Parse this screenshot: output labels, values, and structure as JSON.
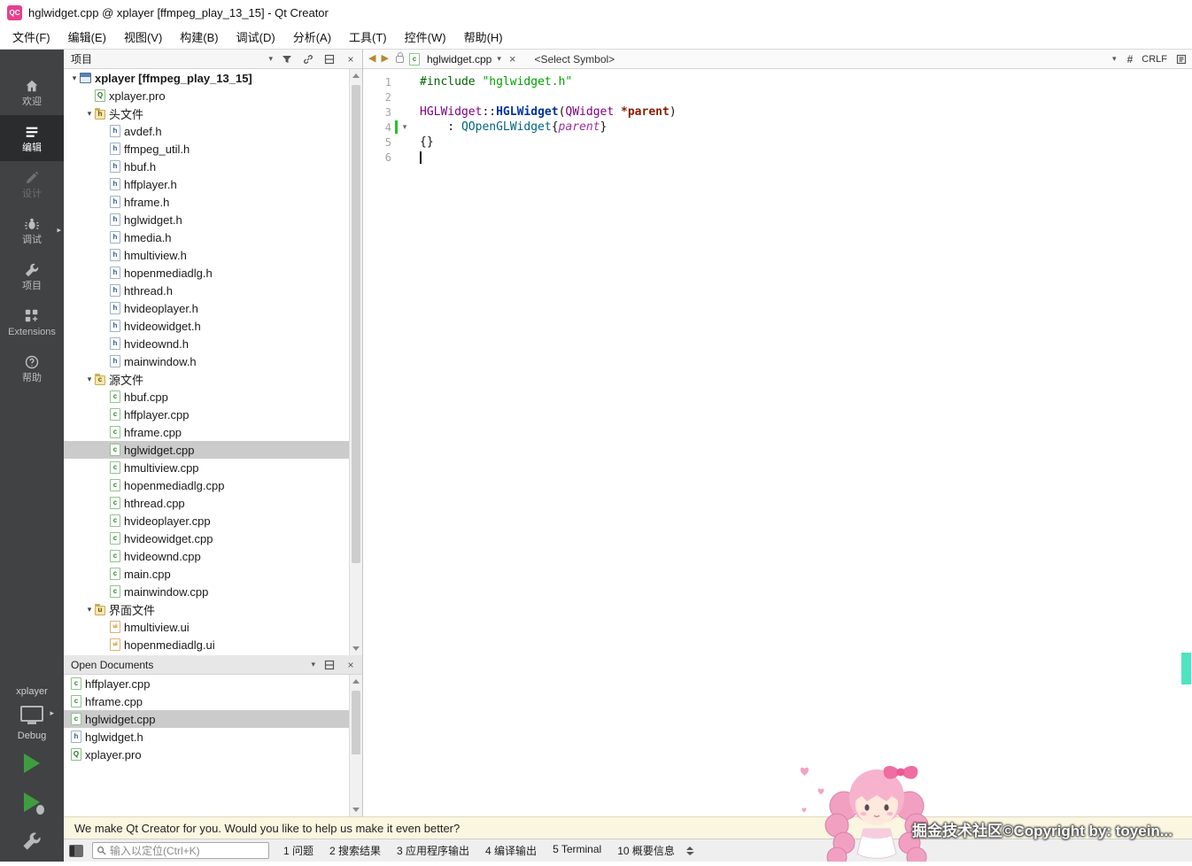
{
  "window": {
    "logo_text": "QC",
    "title": "hglwidget.cpp @ xplayer [ffmpeg_play_13_15] - Qt Creator"
  },
  "menu": {
    "items": [
      {
        "label": "文件(F)"
      },
      {
        "label": "编辑(E)"
      },
      {
        "label": "视图(V)"
      },
      {
        "label": "构建(B)"
      },
      {
        "label": "调试(D)"
      },
      {
        "label": "分析(A)"
      },
      {
        "label": "工具(T)"
      },
      {
        "label": "控件(W)"
      },
      {
        "label": "帮助(H)"
      }
    ]
  },
  "modebar": {
    "modes": [
      {
        "label": "欢迎",
        "icon": "home"
      },
      {
        "label": "编辑",
        "icon": "edit",
        "selected": true
      },
      {
        "label": "设计",
        "icon": "design",
        "disabled": true
      },
      {
        "label": "调试",
        "icon": "debug",
        "flyout": true
      },
      {
        "label": "项目",
        "icon": "wrench"
      },
      {
        "label": "Extensions",
        "icon": "extensions"
      },
      {
        "label": "帮助",
        "icon": "help"
      }
    ],
    "kit_selector": {
      "project": "xplayer",
      "config": "Debug"
    }
  },
  "project_panel": {
    "title": "项目",
    "tree": [
      {
        "label": "xplayer [ffmpeg_play_13_15]",
        "level": 0,
        "icon": "project",
        "expander": true,
        "bold": true
      },
      {
        "label": "xplayer.pro",
        "level": 1,
        "icon": "pro"
      },
      {
        "label": "头文件",
        "level": 1,
        "icon": "folder-h",
        "expander": true
      },
      {
        "label": "avdef.h",
        "level": 2,
        "icon": "h"
      },
      {
        "label": "ffmpeg_util.h",
        "level": 2,
        "icon": "h"
      },
      {
        "label": "hbuf.h",
        "level": 2,
        "icon": "h"
      },
      {
        "label": "hffplayer.h",
        "level": 2,
        "icon": "h"
      },
      {
        "label": "hframe.h",
        "level": 2,
        "icon": "h"
      },
      {
        "label": "hglwidget.h",
        "level": 2,
        "icon": "h"
      },
      {
        "label": "hmedia.h",
        "level": 2,
        "icon": "h"
      },
      {
        "label": "hmultiview.h",
        "level": 2,
        "icon": "h"
      },
      {
        "label": "hopenmediadlg.h",
        "level": 2,
        "icon": "h"
      },
      {
        "label": "hthread.h",
        "level": 2,
        "icon": "h"
      },
      {
        "label": "hvideoplayer.h",
        "level": 2,
        "icon": "h"
      },
      {
        "label": "hvideowidget.h",
        "level": 2,
        "icon": "h"
      },
      {
        "label": "hvideownd.h",
        "level": 2,
        "icon": "h"
      },
      {
        "label": "mainwindow.h",
        "level": 2,
        "icon": "h"
      },
      {
        "label": "源文件",
        "level": 1,
        "icon": "folder-cpp",
        "expander": true
      },
      {
        "label": "hbuf.cpp",
        "level": 2,
        "icon": "cpp"
      },
      {
        "label": "hffplayer.cpp",
        "level": 2,
        "icon": "cpp"
      },
      {
        "label": "hframe.cpp",
        "level": 2,
        "icon": "cpp"
      },
      {
        "label": "hglwidget.cpp",
        "level": 2,
        "icon": "cpp",
        "selected": true
      },
      {
        "label": "hmultiview.cpp",
        "level": 2,
        "icon": "cpp"
      },
      {
        "label": "hopenmediadlg.cpp",
        "level": 2,
        "icon": "cpp"
      },
      {
        "label": "hthread.cpp",
        "level": 2,
        "icon": "cpp"
      },
      {
        "label": "hvideoplayer.cpp",
        "level": 2,
        "icon": "cpp"
      },
      {
        "label": "hvideowidget.cpp",
        "level": 2,
        "icon": "cpp"
      },
      {
        "label": "hvideownd.cpp",
        "level": 2,
        "icon": "cpp"
      },
      {
        "label": "main.cpp",
        "level": 2,
        "icon": "cpp"
      },
      {
        "label": "mainwindow.cpp",
        "level": 2,
        "icon": "cpp"
      },
      {
        "label": "界面文件",
        "level": 1,
        "icon": "folder-ui",
        "expander": true
      },
      {
        "label": "hmultiview.ui",
        "level": 2,
        "icon": "ui"
      },
      {
        "label": "hopenmediadlg.ui",
        "level": 2,
        "icon": "ui"
      }
    ]
  },
  "open_documents": {
    "title": "Open Documents",
    "items": [
      {
        "label": "hffplayer.cpp",
        "icon": "cpp"
      },
      {
        "label": "hframe.cpp",
        "icon": "cpp"
      },
      {
        "label": "hglwidget.cpp",
        "icon": "cpp",
        "selected": true
      },
      {
        "label": "hglwidget.h",
        "icon": "h"
      },
      {
        "label": "xplayer.pro",
        "icon": "pro"
      }
    ]
  },
  "editor": {
    "toolbar": {
      "file_name": "hglwidget.cpp",
      "symbol_placeholder": "<Select Symbol>",
      "annotate_label": "#",
      "line_ending": "CRLF"
    },
    "lines": [
      {
        "num": "1",
        "segments": [
          {
            "text": "#include ",
            "cls": "pp"
          },
          {
            "text": "\"hglwidget.h\"",
            "cls": "str"
          }
        ]
      },
      {
        "num": "2",
        "segments": []
      },
      {
        "num": "3",
        "segments": [
          {
            "text": "HGLWidget",
            "cls": "type"
          },
          {
            "text": "::",
            "cls": "pl"
          },
          {
            "text": "HGLWidget",
            "cls": "fn"
          },
          {
            "text": "(",
            "cls": "pl"
          },
          {
            "text": "QWidget",
            "cls": "type"
          },
          {
            "text": " ",
            "cls": "pl"
          },
          {
            "text": "*parent",
            "cls": "arg"
          },
          {
            "text": ")",
            "cls": "pl"
          }
        ]
      },
      {
        "num": "4",
        "segments": [
          {
            "text": "    : ",
            "cls": "pl"
          },
          {
            "text": "QOpenGLWidget",
            "cls": "type2"
          },
          {
            "text": "{",
            "cls": "pl"
          },
          {
            "text": "parent",
            "cls": "fld"
          },
          {
            "text": "}",
            "cls": "pl"
          }
        ],
        "changed": true,
        "fold": true
      },
      {
        "num": "5",
        "segments": [
          {
            "text": "{}",
            "cls": "pl"
          }
        ]
      },
      {
        "num": "6",
        "segments": [],
        "caret": true
      }
    ]
  },
  "notification": {
    "text": "We make Qt Creator for you. Would you like to help us make it even better?"
  },
  "statusbar": {
    "locator_placeholder": "输入以定位(Ctrl+K)",
    "panes": [
      {
        "label": "1 问题"
      },
      {
        "label": "2 搜索结果"
      },
      {
        "label": "3 应用程序输出"
      },
      {
        "label": "4 编译输出"
      },
      {
        "label": "5 Terminal"
      },
      {
        "label": "10 概要信息"
      }
    ]
  },
  "watermark": {
    "text": "掘金技术社区©Copyright by: toyein..."
  },
  "colors": {
    "run_green": "#3f9d3f",
    "change_marker": "#21c421",
    "selection": "#cbcbcb",
    "logo_pink": "#e5418d",
    "cyan_marker": "#4fe3c1",
    "modebar_bg": "#404244",
    "notif_bg": "#faf6e0"
  }
}
